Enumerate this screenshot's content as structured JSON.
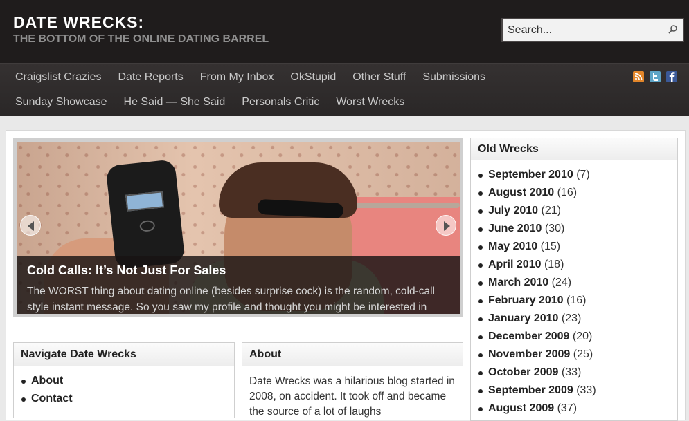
{
  "header": {
    "title": "DATE WRECKS:",
    "tagline": "THE BOTTOM OF THE ONLINE DATING BARREL",
    "search_placeholder": "Search..."
  },
  "nav": {
    "row1": [
      "Craigslist Crazies",
      "Date Reports",
      "From My Inbox",
      "OkStupid",
      "Other Stuff",
      "Submissions"
    ],
    "row2": [
      "Sunday Showcase",
      "He Said — She Said",
      "Personals Critic",
      "Worst Wrecks"
    ],
    "social": [
      "rss-icon",
      "twitter-icon",
      "facebook-icon"
    ]
  },
  "slider": {
    "title": "Cold Calls: It’s Not Just For Sales",
    "excerpt": "The WORST thing about dating online (besides surprise cock) is the random, cold-call style instant message. So you saw my profile and thought you might be interested in"
  },
  "widgets": {
    "navigate": {
      "title": "Navigate Date Wrecks",
      "items": [
        "About",
        "Contact"
      ]
    },
    "about": {
      "title": "About",
      "text": "Date Wrecks was a hilarious blog started in 2008, on accident. It took off and became the source of a lot of laughs"
    },
    "old_wrecks": {
      "title": "Old Wrecks",
      "items": [
        {
          "month": "September 2010",
          "count": "(7)"
        },
        {
          "month": "August 2010",
          "count": "(16)"
        },
        {
          "month": "July 2010",
          "count": "(21)"
        },
        {
          "month": "June 2010",
          "count": "(30)"
        },
        {
          "month": "May 2010",
          "count": "(15)"
        },
        {
          "month": "April 2010",
          "count": "(18)"
        },
        {
          "month": "March 2010",
          "count": "(24)"
        },
        {
          "month": "February 2010",
          "count": "(16)"
        },
        {
          "month": "January 2010",
          "count": "(23)"
        },
        {
          "month": "December 2009",
          "count": "(20)"
        },
        {
          "month": "November 2009",
          "count": "(25)"
        },
        {
          "month": "October 2009",
          "count": "(33)"
        },
        {
          "month": "September 2009",
          "count": "(33)"
        },
        {
          "month": "August 2009",
          "count": "(37)"
        }
      ]
    }
  },
  "colors": {
    "header_bg": "#1f1c1c",
    "nav_bg": "#2f2c2c",
    "nav_text": "#c9c9c9",
    "tagline": "#8e8e8e"
  }
}
